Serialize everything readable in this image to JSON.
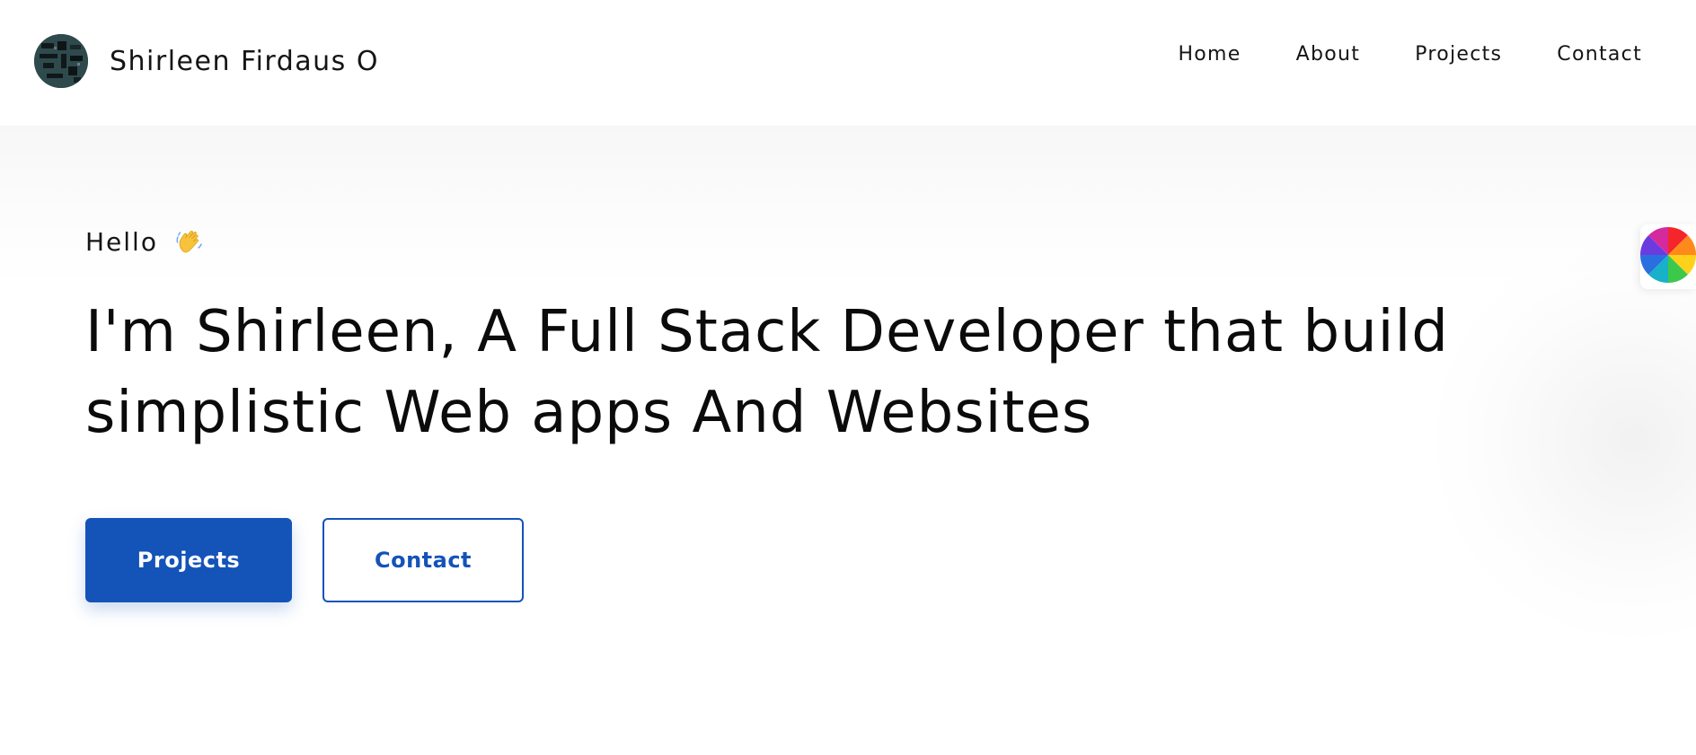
{
  "header": {
    "brand_name": "Shirleen Firdaus O",
    "nav": [
      {
        "label": "Home"
      },
      {
        "label": "About"
      },
      {
        "label": "Projects"
      },
      {
        "label": "Contact"
      }
    ]
  },
  "hero": {
    "greeting": "Hello",
    "greeting_icon": "waving-hand-icon",
    "headline": "I'm Shirleen, A Full Stack Developer that build simplistic Web apps And Websites",
    "primary_button": "Projects",
    "secondary_button": "Contact"
  },
  "theme": {
    "accent": "#1453b8",
    "text": "#111111",
    "background": "#ffffff"
  },
  "floating": {
    "color_picker_icon": "color-wheel-icon"
  }
}
